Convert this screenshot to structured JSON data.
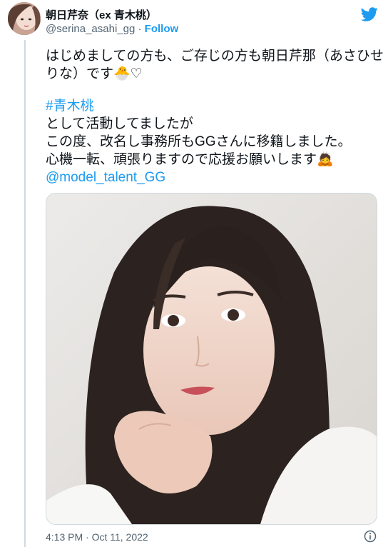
{
  "author": {
    "display_name": "朝日芹奈（ex 青木桃）",
    "handle": "@serina_asahi_gg",
    "separator": " · ",
    "follow_label": "Follow"
  },
  "tweet": {
    "lines": [
      "はじめましての方も、ご存じの方も朝日芹那（あさひせ",
      "りな）です🐣♡",
      "",
      "#青木桃",
      "として活動してましたが",
      "この度、改名し事務所もGGさんに移籍しました。",
      "心機一転、頑張りますので応援お願いします🙇",
      "@model_talent_GG"
    ]
  },
  "timestamp": "4:13 PM · Oct 11, 2022",
  "colors": {
    "link": "#1d9bf0",
    "text": "#0f1419",
    "muted": "#536471",
    "border": "#cfd9de"
  },
  "icons": {
    "brand": "twitter-bird-icon",
    "info": "info-icon"
  }
}
